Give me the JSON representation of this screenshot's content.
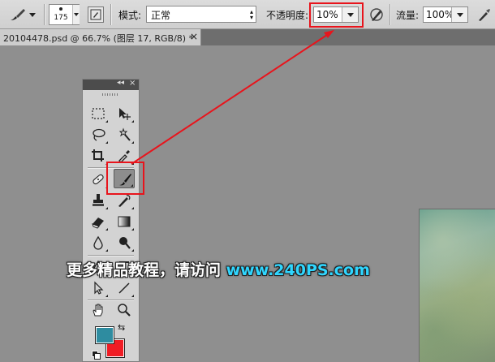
{
  "options_bar": {
    "brush_size": "175",
    "mode_label": "模式:",
    "mode_value": "正常",
    "opacity_label": "不透明度:",
    "opacity_value": "10%",
    "flow_label": "流量:",
    "flow_value": "100%"
  },
  "document_tab": {
    "title": "20104478.psd @ 66.7% (图层 17, RGB/8) *",
    "close": "×"
  },
  "tools_panel": {
    "collapse": "◂◂",
    "close": "×",
    "foreground_color": "#2e8ca0",
    "background_color": "#f01c24"
  },
  "watermark": {
    "text_cn": "更多精品教程，请访问 ",
    "text_url": "www.240PS.com"
  },
  "annotation": {
    "color": "#e8141c"
  }
}
